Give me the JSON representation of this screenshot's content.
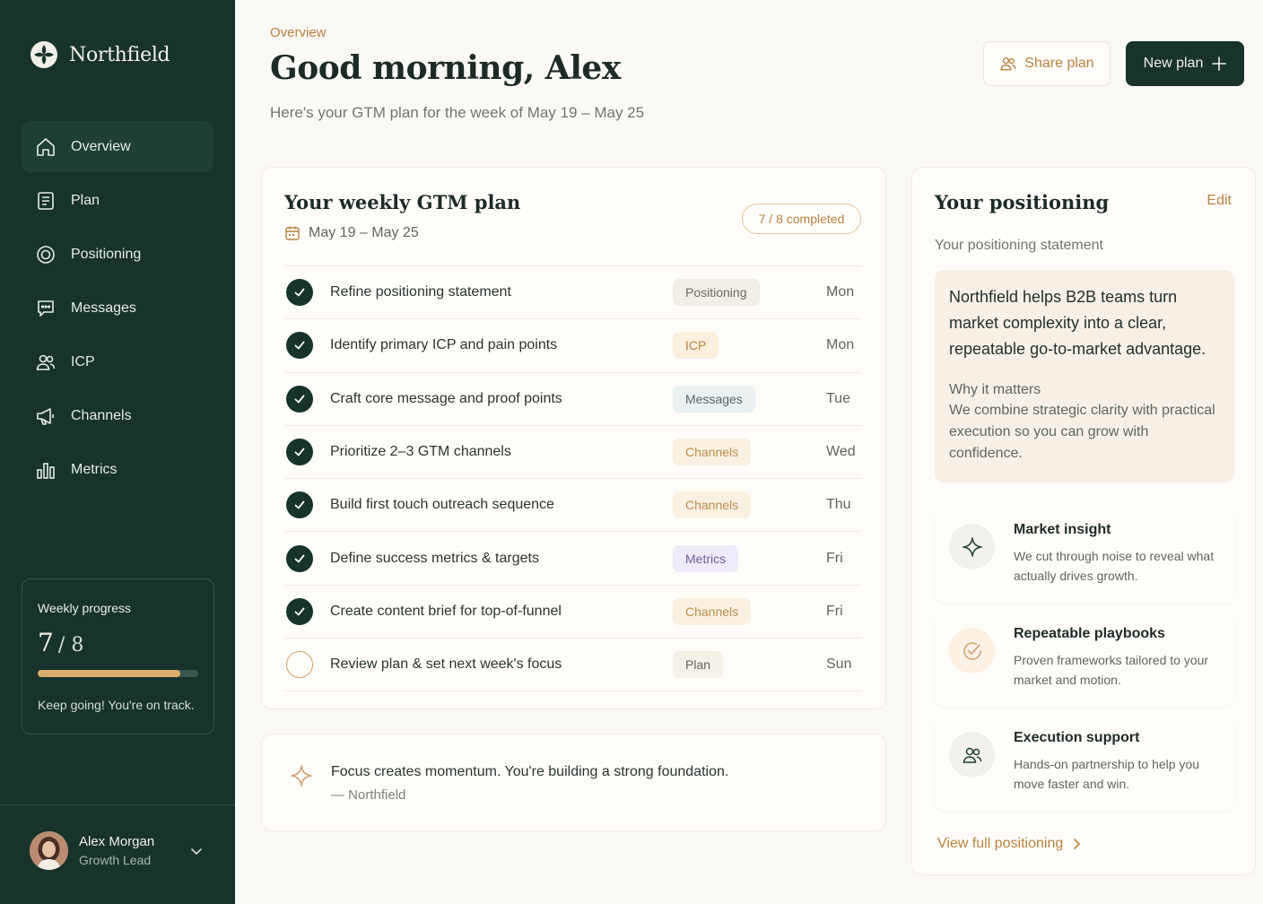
{
  "brand": {
    "name": "Northfield"
  },
  "nav": [
    {
      "label": "Overview",
      "icon": "home-icon",
      "active": true
    },
    {
      "label": "Plan",
      "icon": "document-icon"
    },
    {
      "label": "Positioning",
      "icon": "target-icon"
    },
    {
      "label": "Messages",
      "icon": "chat-icon"
    },
    {
      "label": "ICP",
      "icon": "users-icon"
    },
    {
      "label": "Channels",
      "icon": "megaphone-icon"
    },
    {
      "label": "Metrics",
      "icon": "bar-chart-icon"
    }
  ],
  "progress": {
    "title": "Weekly progress",
    "done": "7",
    "total": "/ 8",
    "fraction": 0.89,
    "note": "Keep going! You're on track."
  },
  "user": {
    "name": "Alex Morgan",
    "role": "Growth Lead"
  },
  "header": {
    "crumb": "Overview",
    "greeting": "Good morning, Alex",
    "subtitle": "Here's your GTM plan for the week of May 19 – May 25",
    "share_label": "Share plan",
    "new_label": "New plan"
  },
  "plan": {
    "title": "Your weekly GTM plan",
    "date_range": "May 19 – May 25",
    "completed": "7 / 8 completed",
    "tasks": [
      {
        "label": "Refine positioning statement",
        "tag": "Positioning",
        "tag_type": "positioning",
        "day": "Mon",
        "done": true
      },
      {
        "label": "Identify primary ICP and pain points",
        "tag": "ICP",
        "tag_type": "icp",
        "day": "Mon",
        "done": true
      },
      {
        "label": "Craft core message and proof points",
        "tag": "Messages",
        "tag_type": "messages",
        "day": "Tue",
        "done": true
      },
      {
        "label": "Prioritize 2–3 GTM channels",
        "tag": "Channels",
        "tag_type": "channels",
        "day": "Wed",
        "done": true
      },
      {
        "label": "Build first touch outreach sequence",
        "tag": "Channels",
        "tag_type": "channels",
        "day": "Thu",
        "done": true
      },
      {
        "label": "Define success metrics & targets",
        "tag": "Metrics",
        "tag_type": "metrics",
        "day": "Fri",
        "done": true
      },
      {
        "label": "Create content brief for top-of-funnel",
        "tag": "Channels",
        "tag_type": "channels",
        "day": "Fri",
        "done": true
      },
      {
        "label": "Review plan & set next week's focus",
        "tag": "Plan",
        "tag_type": "plan",
        "day": "Sun",
        "done": false
      }
    ]
  },
  "quote": {
    "text": "Focus creates momentum. You're building a strong foundation.",
    "source": "— Northfield"
  },
  "positioning": {
    "title": "Your positioning",
    "edit_label": "Edit",
    "statement_label": "Your positioning statement",
    "statement": "Northfield helps B2B teams turn market complexity into a clear, repeatable go-to-market advantage.",
    "why_title": "Why it matters",
    "why_text": "We combine strategic clarity with practical execution so you can grow with confidence.",
    "features": [
      {
        "title": "Market insight",
        "text": "We cut through noise to reveal what actually drives growth.",
        "icon": "sparkle-icon"
      },
      {
        "title": "Repeatable playbooks",
        "text": "Proven frameworks tailored to your market and motion.",
        "icon": "check-circle-icon"
      },
      {
        "title": "Execution support",
        "text": "Hands-on partnership to help you move faster and win.",
        "icon": "team-icon"
      }
    ],
    "view_label": "View full positioning"
  },
  "colors": {
    "sidebar": "#17332B",
    "accent": "#B7833D",
    "progress": "#D9AE6C",
    "background": "#FBF9F5"
  }
}
